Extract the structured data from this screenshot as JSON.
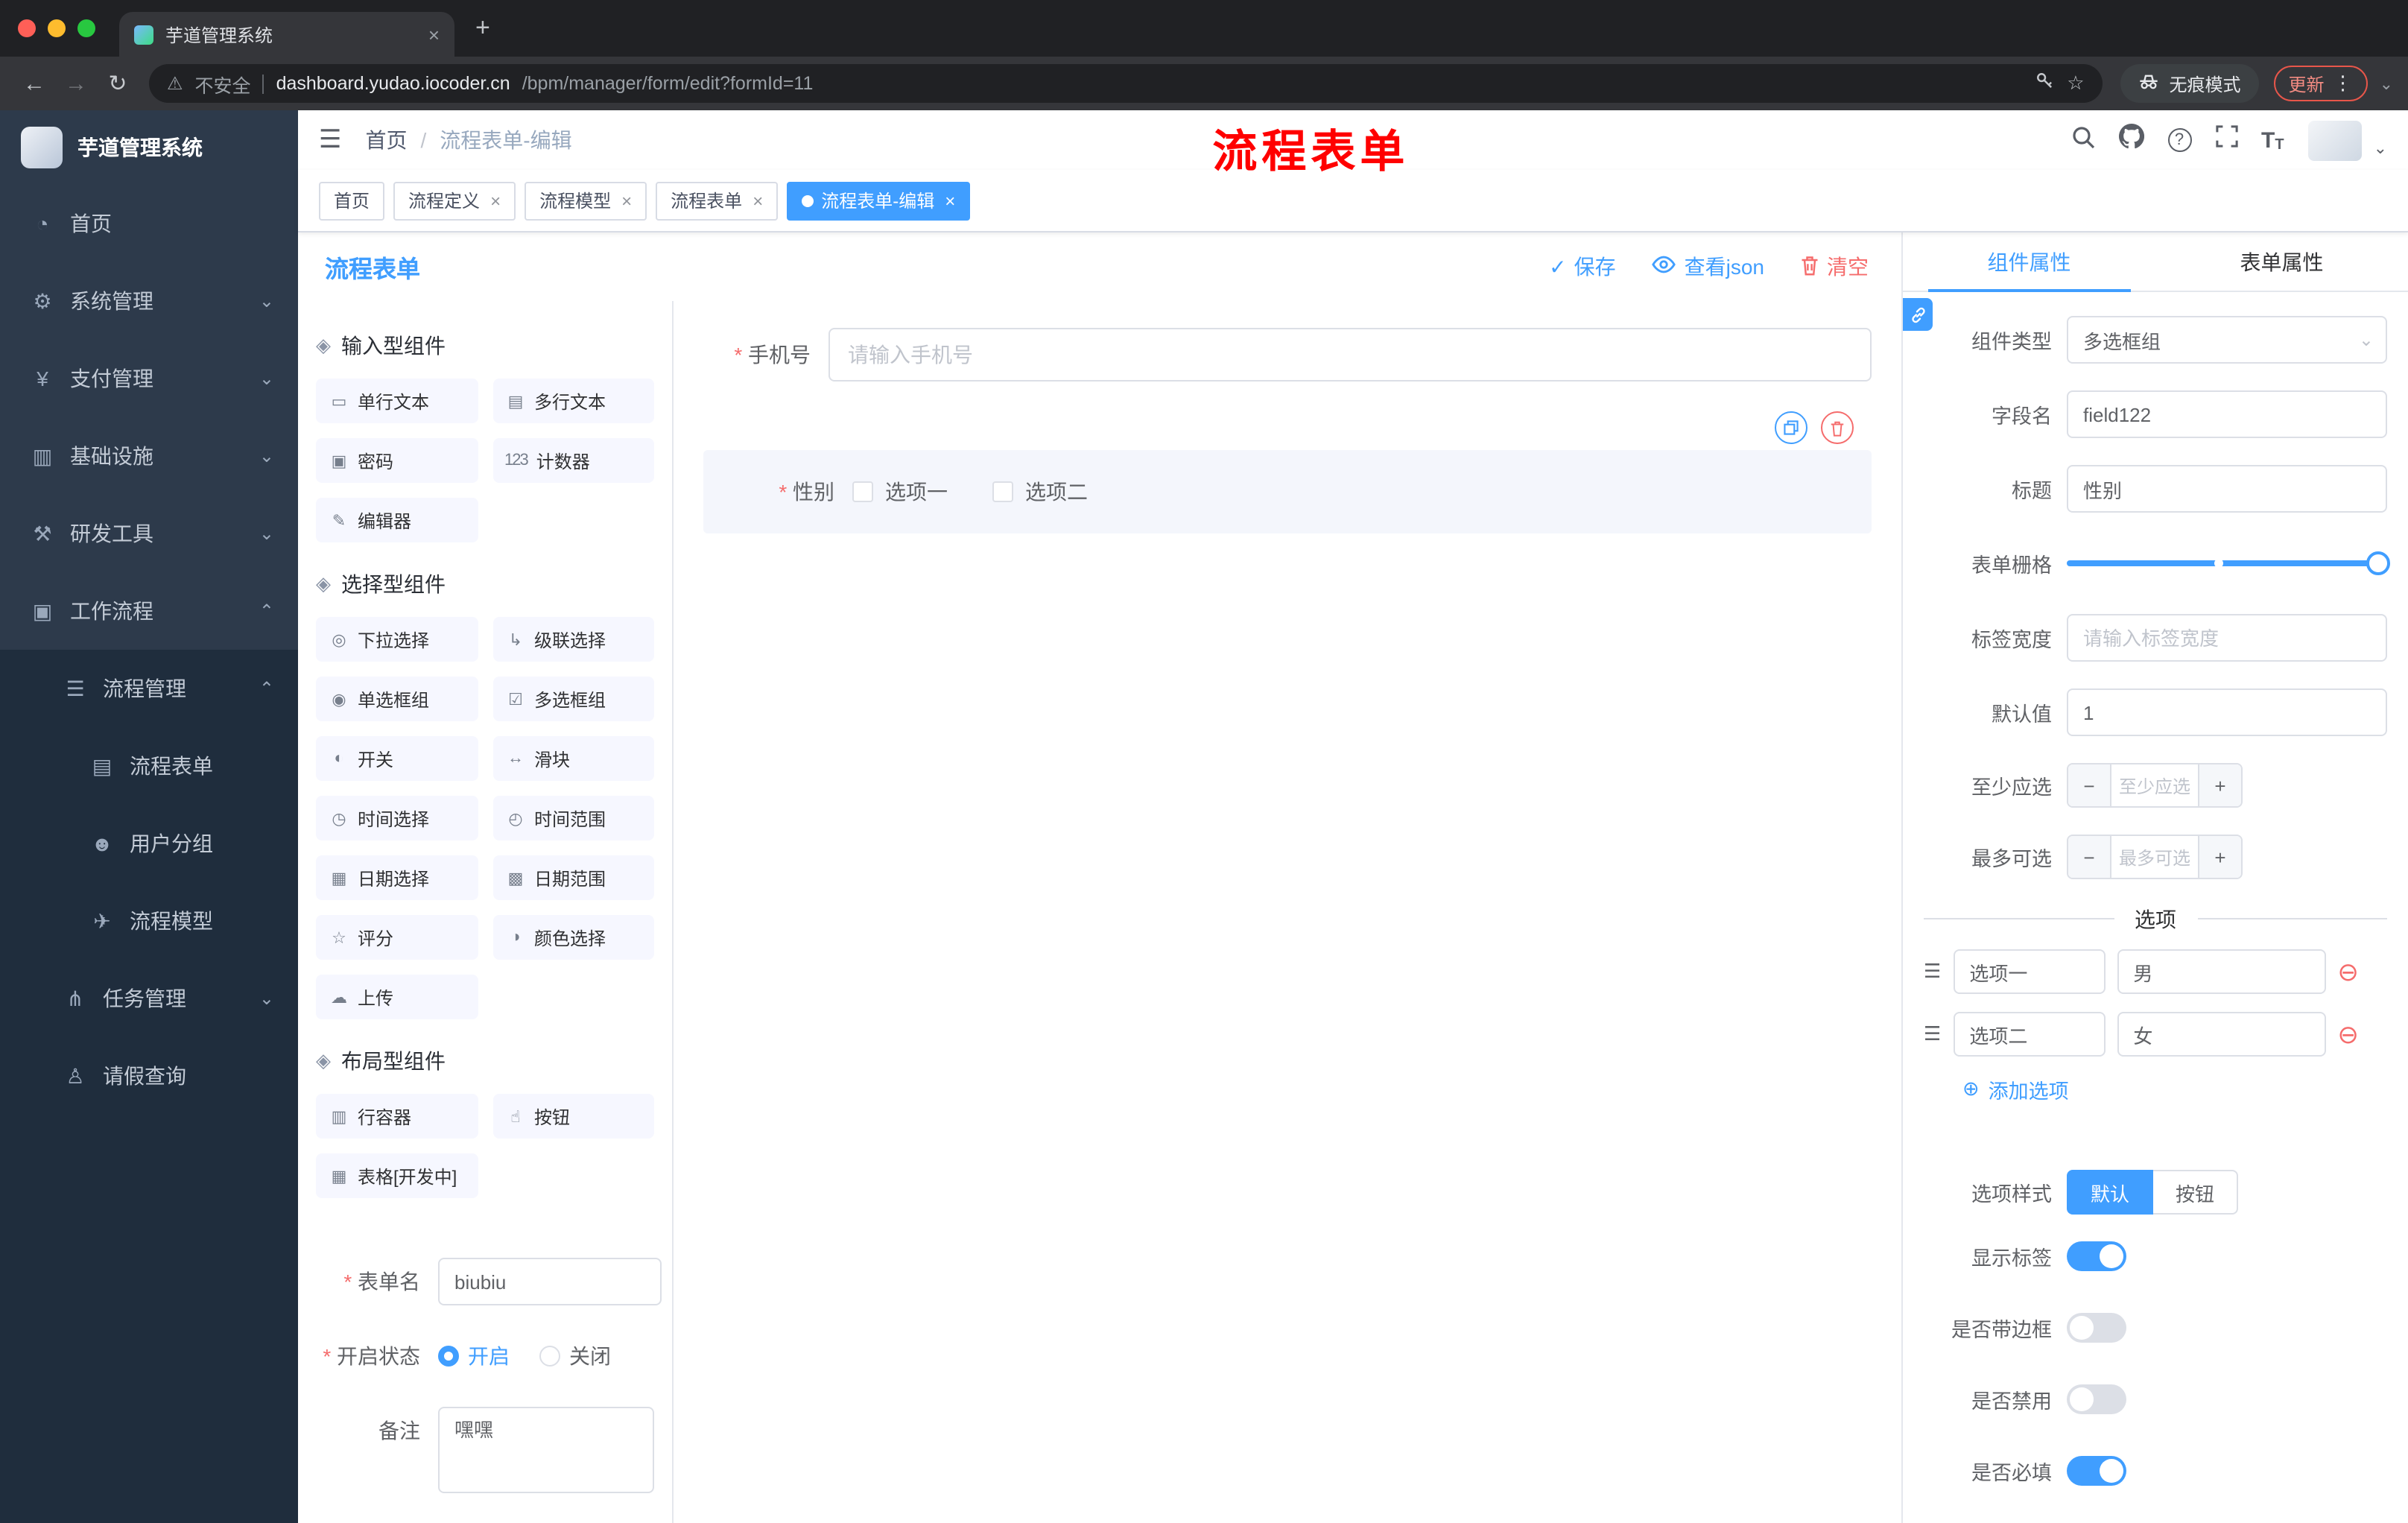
{
  "glyphs": {
    "close": "×",
    "newtab": "+",
    "back": "←",
    "forward": "→",
    "reload": "↻",
    "warn": "⚠",
    "star": "☆",
    "kebab": "⋮",
    "caret_down": "⌄",
    "check": "✓",
    "hamburger": "☰",
    "group": "◈",
    "drag": "☰",
    "plus_circle": "⊕",
    "minus_circle": "⊖",
    "minus": "−",
    "plus": "+",
    "question": "?",
    "big_t": "T",
    "small_t": "T"
  },
  "browser": {
    "tab_title": "芋道管理系统",
    "security_label": "不安全",
    "url_domain": "dashboard.yudao.iocoder.cn",
    "url_path": "/bpm/manager/form/edit?formId=11",
    "incognito_label": "无痕模式",
    "update_label": "更新"
  },
  "navbar": {
    "breadcrumb_root": "首页",
    "breadcrumb_sep": "/",
    "breadcrumb_current": "流程表单-编辑",
    "annotation": "流程表单",
    "annotation_color": "#ff0000"
  },
  "tags": [
    {
      "label": "首页",
      "active": false,
      "closable": false
    },
    {
      "label": "流程定义",
      "active": false,
      "closable": true
    },
    {
      "label": "流程模型",
      "active": false,
      "closable": true
    },
    {
      "label": "流程表单",
      "active": false,
      "closable": true
    },
    {
      "label": "流程表单-编辑",
      "active": true,
      "closable": true
    }
  ],
  "sidebar": {
    "logo_title": "芋道管理系统",
    "items": [
      {
        "glyph": "◔",
        "label": "首页",
        "arrow": "",
        "level": 0,
        "icon": "dashboard-icon"
      },
      {
        "glyph": "⚙",
        "label": "系统管理",
        "arrow": "⌄",
        "level": 0,
        "icon": "gear-icon"
      },
      {
        "glyph": "¥",
        "label": "支付管理",
        "arrow": "⌄",
        "level": 0,
        "icon": "yen-icon"
      },
      {
        "glyph": "▥",
        "label": "基础设施",
        "arrow": "⌄",
        "level": 0,
        "icon": "infrastructure-icon"
      },
      {
        "glyph": "⚒",
        "label": "研发工具",
        "arrow": "⌄",
        "level": 0,
        "icon": "tools-icon"
      },
      {
        "glyph": "▣",
        "label": "工作流程",
        "arrow": "⌃",
        "level": 0,
        "icon": "workflow-icon"
      },
      {
        "glyph": "☰",
        "label": "流程管理",
        "arrow": "⌃",
        "level": 1,
        "icon": "process-list-icon"
      },
      {
        "glyph": "▤",
        "label": "流程表单",
        "arrow": "",
        "level": 2,
        "icon": "form-document-icon"
      },
      {
        "glyph": "☻",
        "label": "用户分组",
        "arrow": "",
        "level": 2,
        "icon": "user-group-icon"
      },
      {
        "glyph": "✈",
        "label": "流程模型",
        "arrow": "",
        "level": 2,
        "icon": "paper-plane-icon"
      },
      {
        "glyph": "⋔",
        "label": "任务管理",
        "arrow": "⌄",
        "level": 1,
        "icon": "branch-icon"
      },
      {
        "glyph": "♙",
        "label": "请假查询",
        "arrow": "",
        "level": 1,
        "icon": "person-icon"
      }
    ]
  },
  "designer": {
    "title": "流程表单",
    "save_label": "保存",
    "view_json_label": "查看json",
    "clear_label": "清空",
    "groups": [
      {
        "title": "输入型组件",
        "items": [
          {
            "g": "▭",
            "label": "单行文本",
            "icon": "single-line-text-icon"
          },
          {
            "g": "▤",
            "label": "多行文本",
            "icon": "multi-line-text-icon"
          },
          {
            "g": "▣",
            "label": "密码",
            "icon": "password-lock-icon"
          },
          {
            "g": "123",
            "label": "计数器",
            "icon": "counter-icon"
          },
          {
            "g": "✎",
            "label": "编辑器",
            "icon": "editor-icon"
          }
        ]
      },
      {
        "title": "选择型组件",
        "items": [
          {
            "g": "◎",
            "label": "下拉选择",
            "icon": "select-dropdown-icon"
          },
          {
            "g": "↳",
            "label": "级联选择",
            "icon": "cascader-icon"
          },
          {
            "g": "◉",
            "label": "单选框组",
            "icon": "radio-group-icon"
          },
          {
            "g": "☑",
            "label": "多选框组",
            "icon": "checkbox-group-icon"
          },
          {
            "g": "◐",
            "label": "开关",
            "icon": "switch-icon"
          },
          {
            "g": "↔",
            "label": "滑块",
            "icon": "slider-icon"
          },
          {
            "g": "◷",
            "label": "时间选择",
            "icon": "time-picker-icon"
          },
          {
            "g": "◴",
            "label": "时间范围",
            "icon": "time-range-icon"
          },
          {
            "g": "▦",
            "label": "日期选择",
            "icon": "date-picker-icon"
          },
          {
            "g": "▩",
            "label": "日期范围",
            "icon": "date-range-icon"
          },
          {
            "g": "☆",
            "label": "评分",
            "icon": "rate-icon"
          },
          {
            "g": "◑",
            "label": "颜色选择",
            "icon": "color-picker-icon"
          },
          {
            "g": "☁",
            "label": "上传",
            "icon": "upload-icon"
          }
        ]
      },
      {
        "title": "布局型组件",
        "items": [
          {
            "g": "▥",
            "label": "行容器",
            "icon": "row-container-icon"
          },
          {
            "g": "☝",
            "label": "按钮",
            "icon": "button-icon"
          },
          {
            "g": "▦",
            "label": "表格[开发中]",
            "icon": "table-icon"
          }
        ]
      }
    ],
    "meta": {
      "name_label": "表单名",
      "name_value": "biubiu",
      "status_label": "开启状态",
      "status_on": "开启",
      "status_off": "关闭",
      "remark_label": "备注",
      "remark_value": "嘿嘿"
    },
    "canvas": {
      "phone_label": "手机号",
      "phone_placeholder": "请输入手机号",
      "gender_label": "性别",
      "gender_opt1": "选项一",
      "gender_opt2": "选项二"
    }
  },
  "props": {
    "tab_component": "组件属性",
    "tab_form": "表单属性",
    "type_label": "组件类型",
    "type_value": "多选框组",
    "field_label": "字段名",
    "field_value": "field122",
    "title_label": "标题",
    "title_value": "性别",
    "grid_label": "表单栅格",
    "labelwidth_label": "标签宽度",
    "labelwidth_placeholder": "请输入标签宽度",
    "default_label": "默认值",
    "default_value": "1",
    "min_label": "至少应选",
    "min_placeholder": "至少应选",
    "max_label": "最多可选",
    "max_placeholder": "最多可选",
    "options_divider": "选项",
    "options": [
      {
        "name": "选项一",
        "value": "男"
      },
      {
        "name": "选项二",
        "value": "女"
      }
    ],
    "add_option_label": "添加选项",
    "style_label": "选项样式",
    "style_default": "默认",
    "style_button": "按钮",
    "switches": [
      {
        "label": "显示标签",
        "on": true
      },
      {
        "label": "是否带边框",
        "on": false
      },
      {
        "label": "是否禁用",
        "on": false
      },
      {
        "label": "是否必填",
        "on": true
      }
    ],
    "accent_color": "#409eff",
    "danger_color": "#f56c6c"
  }
}
